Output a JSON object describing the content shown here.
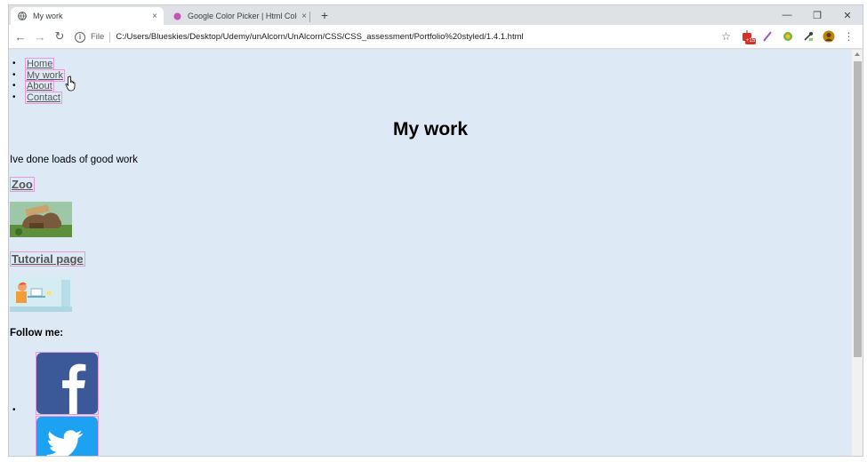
{
  "browser": {
    "tabs": [
      {
        "title": "My work",
        "close": "×"
      },
      {
        "title": "Google Color Picker | Html Color",
        "close": "×"
      }
    ],
    "new_tab": "+",
    "window_controls": {
      "minimize": "—",
      "restore": "❐",
      "close": "✕"
    },
    "nav": {
      "back": "←",
      "forward": "→",
      "reload": "↻"
    },
    "omnibox": {
      "info": "i",
      "scheme": "File",
      "url": "C:/Users/Blueskies/Desktop/Udemy/unAlcorn/UnAlcorn/CSS/CSS_assessment/Portfolio%20styled/1.4.1.html"
    },
    "toolbar_icons": [
      "star-icon",
      "extension-badge-icon",
      "feather-icon",
      "color-extension-icon",
      "eyedropper-icon",
      "profile-avatar",
      "menu-icon"
    ],
    "extension_badge": "+15",
    "menu": "⋮",
    "star": "☆"
  },
  "page": {
    "nav_items": [
      "Home",
      "My work",
      "About",
      "Contact"
    ],
    "heading": "My work",
    "intro": "Ive done loads of good work",
    "projects": [
      {
        "title": "Zoo"
      },
      {
        "title": "Tutorial page"
      }
    ],
    "follow": "Follow me:",
    "social": [
      "facebook-icon",
      "twitter-icon"
    ]
  },
  "colors": {
    "page_bg": "#dde9f5",
    "link_outline": "#e69ad8",
    "facebook_blue": "#3b5998",
    "twitter_blue": "#1da1f2"
  }
}
